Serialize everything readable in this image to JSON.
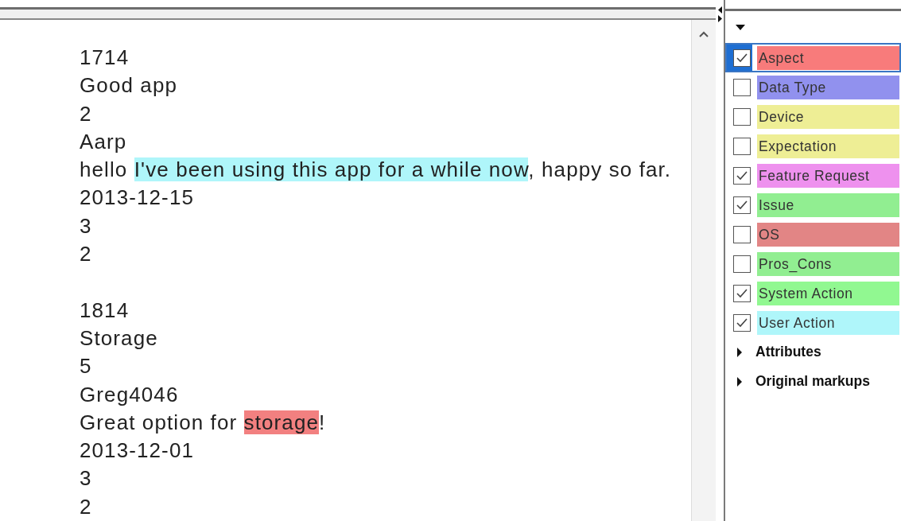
{
  "document": {
    "records": [
      {
        "lines": [
          {
            "segments": [
              {
                "text": "1714"
              }
            ]
          },
          {
            "segments": [
              {
                "text": "Good app"
              }
            ]
          },
          {
            "segments": [
              {
                "text": "2"
              }
            ]
          },
          {
            "segments": [
              {
                "text": "Aarp"
              }
            ]
          },
          {
            "segments": [
              {
                "text": "hello "
              },
              {
                "text": "I've been using this app for a while now",
                "color": "#aff6fa"
              },
              {
                "text": ", happy so far."
              }
            ]
          },
          {
            "segments": [
              {
                "text": "2013-12-15"
              }
            ]
          },
          {
            "segments": [
              {
                "text": "3"
              }
            ]
          },
          {
            "segments": [
              {
                "text": "2"
              }
            ]
          }
        ]
      },
      {
        "lines": [
          {
            "segments": [
              {
                "text": "1814"
              }
            ]
          },
          {
            "segments": [
              {
                "text": "Storage"
              }
            ]
          },
          {
            "segments": [
              {
                "text": "5"
              }
            ]
          },
          {
            "segments": [
              {
                "text": "Greg4046"
              }
            ]
          },
          {
            "segments": [
              {
                "text": "Great option for "
              },
              {
                "text": "storage",
                "color": "#f28080"
              },
              {
                "text": "!"
              }
            ]
          },
          {
            "segments": [
              {
                "text": "2013-12-01"
              }
            ]
          },
          {
            "segments": [
              {
                "text": "3"
              }
            ]
          },
          {
            "segments": [
              {
                "text": "2"
              }
            ]
          }
        ]
      }
    ]
  },
  "categories": [
    {
      "label": "Aspect",
      "checked": true,
      "selected": true,
      "color": "#f87b7b"
    },
    {
      "label": "Data Type",
      "checked": false,
      "selected": false,
      "color": "#9191ee"
    },
    {
      "label": "Device",
      "checked": false,
      "selected": false,
      "color": "#eeee95"
    },
    {
      "label": "Expectation",
      "checked": false,
      "selected": false,
      "color": "#eeee95"
    },
    {
      "label": "Feature Request",
      "checked": true,
      "selected": false,
      "color": "#ee91ee"
    },
    {
      "label": "Issue",
      "checked": true,
      "selected": false,
      "color": "#91ee91"
    },
    {
      "label": "OS",
      "checked": false,
      "selected": false,
      "color": "#e28585"
    },
    {
      "label": "Pros_Cons",
      "checked": false,
      "selected": false,
      "color": "#91ee91"
    },
    {
      "label": "System Action",
      "checked": true,
      "selected": false,
      "color": "#91f891"
    },
    {
      "label": "User Action",
      "checked": true,
      "selected": false,
      "color": "#aff6fa"
    }
  ],
  "sections": [
    {
      "label": "Attributes",
      "expanded": false
    },
    {
      "label": "Original markups",
      "expanded": false
    }
  ]
}
